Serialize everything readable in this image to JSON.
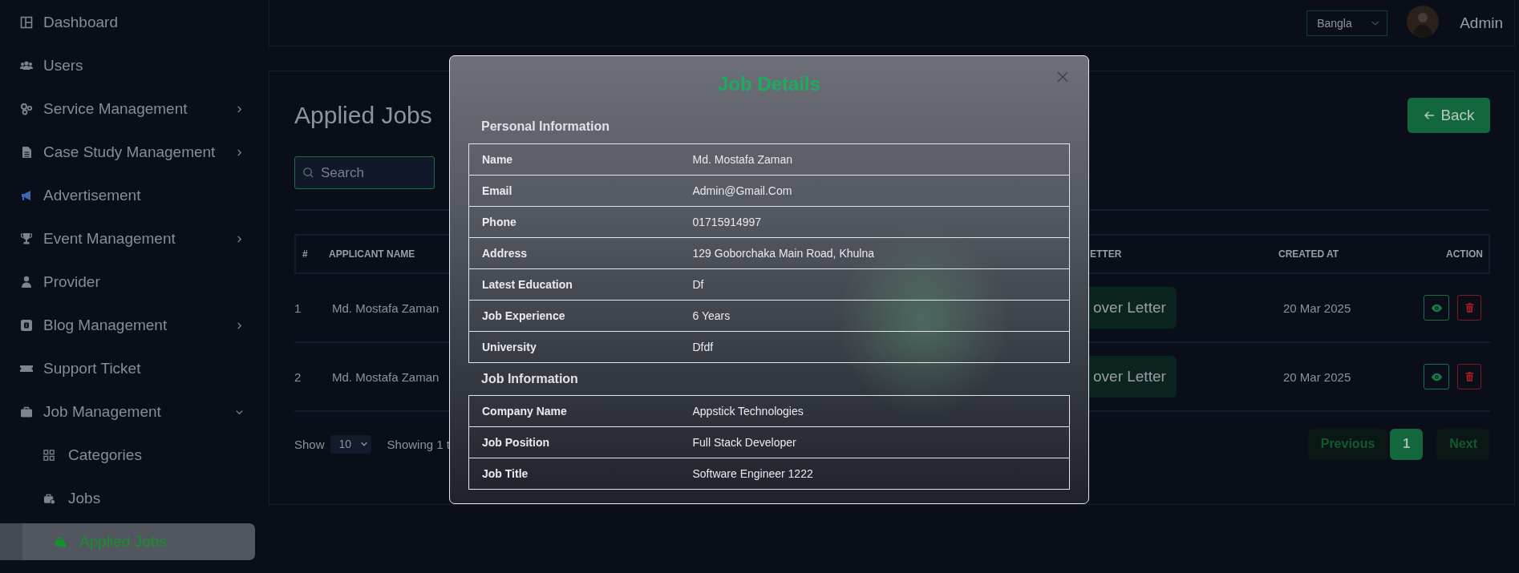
{
  "sidebar": {
    "items": [
      {
        "label": "Dashboard",
        "selected": false
      },
      {
        "label": "Users",
        "selected": false
      },
      {
        "label": "Service Management",
        "selected": false,
        "expanded": false
      },
      {
        "label": "Case Study Management",
        "selected": false,
        "expanded": false
      },
      {
        "label": "Advertisement",
        "selected": false
      },
      {
        "label": "Event Management",
        "selected": false,
        "expanded": false
      },
      {
        "label": "Provider",
        "selected": false
      },
      {
        "label": "Blog Management",
        "selected": false,
        "expanded": false
      },
      {
        "label": "Support Ticket",
        "selected": false
      },
      {
        "label": "Job Management",
        "selected": false,
        "expanded": true,
        "children": [
          {
            "label": "Categories",
            "selected": false
          },
          {
            "label": "Jobs",
            "selected": false
          },
          {
            "label": "Applied Jobs",
            "selected": true
          }
        ]
      }
    ]
  },
  "top_bar": {
    "language": "Bangla",
    "user": "Admin"
  },
  "page": {
    "title": "Applied Jobs",
    "back_button": "Back",
    "search": {
      "placeholder": "Search"
    },
    "table": {
      "columns": [
        "#",
        "APPLICANT NAME",
        "ETTER",
        "CREATED AT",
        "ACTION"
      ],
      "rows": [
        {
          "number": "1",
          "applicant_name": "Md. Mostafa Zaman",
          "cover_letter": "over Letter",
          "created_at": "20 Mar 2025"
        },
        {
          "number": "2",
          "applicant_name": "Md. Mostafa Zaman",
          "cover_letter": "over Letter",
          "created_at": "20 Mar 2025"
        }
      ]
    },
    "footer": {
      "show_label": "Show",
      "page_size": "10",
      "showing": "Showing 1 t",
      "pagination": {
        "previous": {
          "label": "Previous",
          "disabled": true
        },
        "pages": [
          {
            "label": "1",
            "selected": true
          }
        ],
        "next": {
          "label": "Next",
          "disabled": true
        }
      }
    }
  },
  "modal": {
    "title": "Job Details",
    "sections": [
      {
        "heading": "Personal Information",
        "rows": [
          {
            "label": "Name",
            "value": "Md. Mostafa Zaman"
          },
          {
            "label": "Email",
            "value": "Admin@Gmail.Com"
          },
          {
            "label": "Phone",
            "value": "01715914997"
          },
          {
            "label": "Address",
            "value": "129 Goborchaka Main Road, Khulna"
          },
          {
            "label": "Latest Education",
            "value": "Df"
          },
          {
            "label": "Job Experience",
            "value": "6 Years"
          },
          {
            "label": "University",
            "value": "Dfdf"
          }
        ]
      },
      {
        "heading": "Job Information",
        "rows": [
          {
            "label": "Company Name",
            "value": "Appstick Technologies"
          },
          {
            "label": "Job Position",
            "value": "Full Stack Developer"
          },
          {
            "label": "Job Title",
            "value": "Software Engineer 1222"
          }
        ]
      }
    ]
  }
}
